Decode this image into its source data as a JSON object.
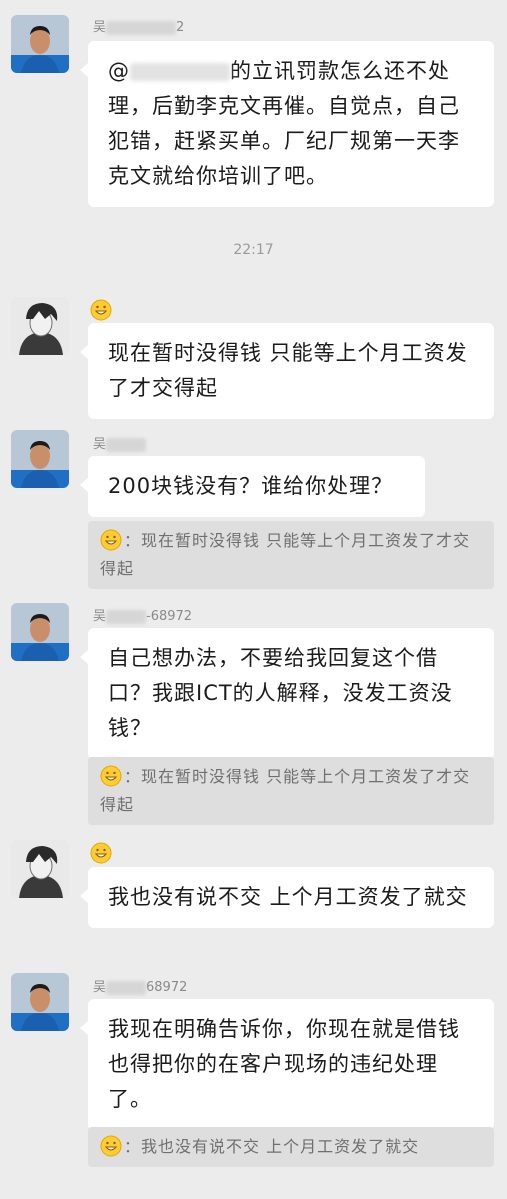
{
  "messages": [
    {
      "sender": "吴",
      "sender_suffix": "2",
      "text_prefix": "@",
      "text": "的立讯罚款怎么还不处理，后勤李克文再催。自觉点，自己犯错，赶紧买单。厂纪厂规第一天李克文就给你培训了吧。"
    },
    {
      "time": "22:17"
    },
    {
      "sender": "",
      "reaction": "grinning-emoji",
      "text": "现在暂时没得钱  只能等上个月工资发了才交得起"
    },
    {
      "sender": "吴",
      "text": "200块钱没有？谁给你处理？",
      "quote": "：现在暂时没得钱  只能等上个月工资发了才交得起"
    },
    {
      "sender": "吴",
      "sender_suffix": "-68972",
      "text": "自己想办法，不要给我回复这个借口？我跟ICT的人解释，没发工资没钱？",
      "quote": "：现在暂时没得钱  只能等上个月工资发了才交得起"
    },
    {
      "sender": "",
      "reaction": "grinning-emoji",
      "text": "我也没有说不交   上个月工资发了就交"
    },
    {
      "sender": "吴",
      "sender_suffix": "68972",
      "text": "我现在明确告诉你，你现在就是借钱也得把你的在客户现场的违纪处理了。",
      "quote": "：我也没有说不交   上个月工资发了就交"
    }
  ],
  "colors": {
    "background": "#ececec",
    "bubble": "#ffffff",
    "quote_bg": "#dedede",
    "avatar_shirt": "#1f6fc4"
  }
}
